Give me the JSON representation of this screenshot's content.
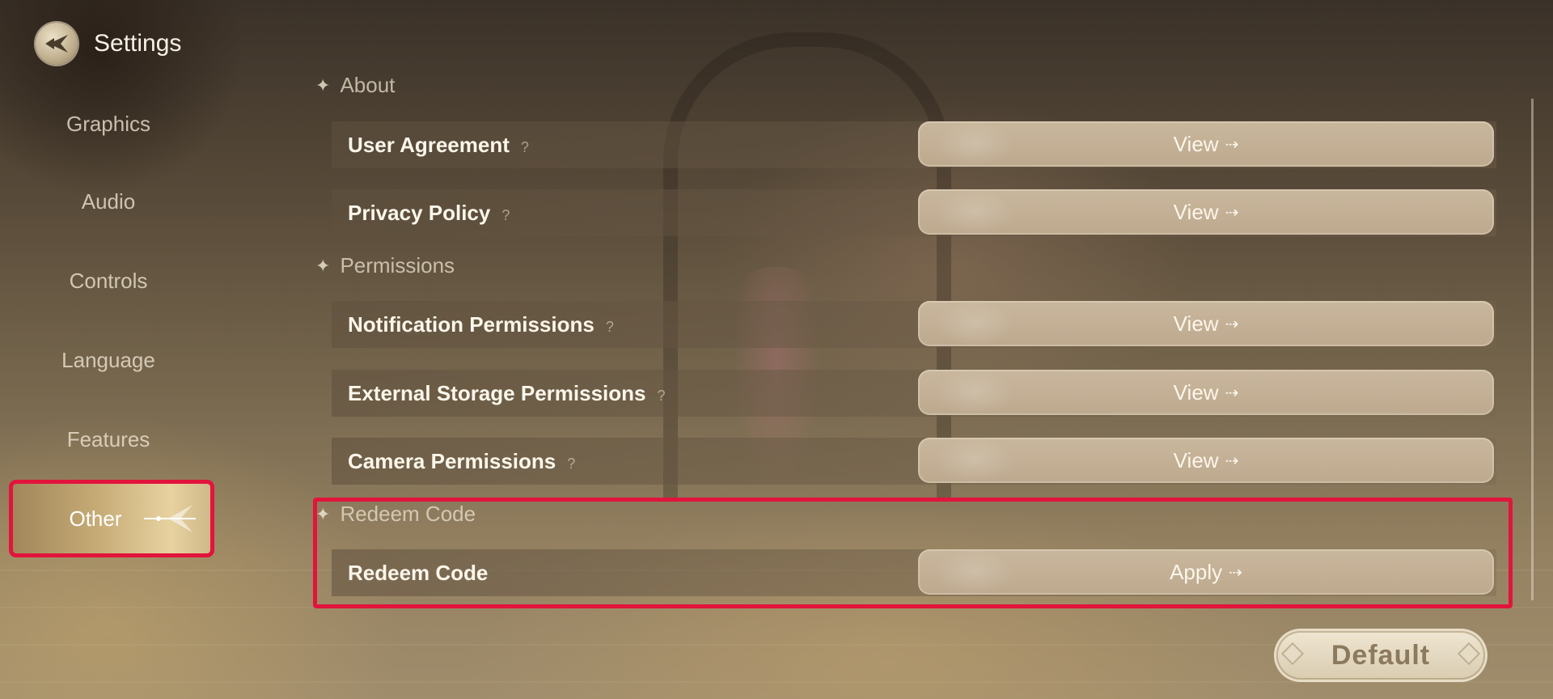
{
  "header": {
    "title": "Settings"
  },
  "sidebar": {
    "items": [
      {
        "label": "Graphics"
      },
      {
        "label": "Audio"
      },
      {
        "label": "Controls"
      },
      {
        "label": "Language"
      },
      {
        "label": "Features"
      },
      {
        "label": "Other",
        "active": true
      }
    ]
  },
  "sections": {
    "about": {
      "title": "About",
      "rows": [
        {
          "label": "User Agreement",
          "button": "View"
        },
        {
          "label": "Privacy Policy",
          "button": "View"
        }
      ]
    },
    "permissions": {
      "title": "Permissions",
      "rows": [
        {
          "label": "Notification Permissions",
          "button": "View"
        },
        {
          "label": "External Storage Permissions",
          "button": "View"
        },
        {
          "label": "Camera Permissions",
          "button": "View"
        }
      ]
    },
    "redeem": {
      "title": "Redeem Code",
      "rows": [
        {
          "label": "Redeem Code",
          "button": "Apply"
        }
      ]
    }
  },
  "footer": {
    "default_label": "Default"
  },
  "icons": {
    "back": "back-emblem-icon",
    "help": "help-icon",
    "arrow": "arrow-right-icon",
    "section": "sparkle-icon"
  },
  "colors": {
    "highlight": "#e2143c",
    "button": "#c4b196",
    "active_tab": "#c8ad78"
  }
}
